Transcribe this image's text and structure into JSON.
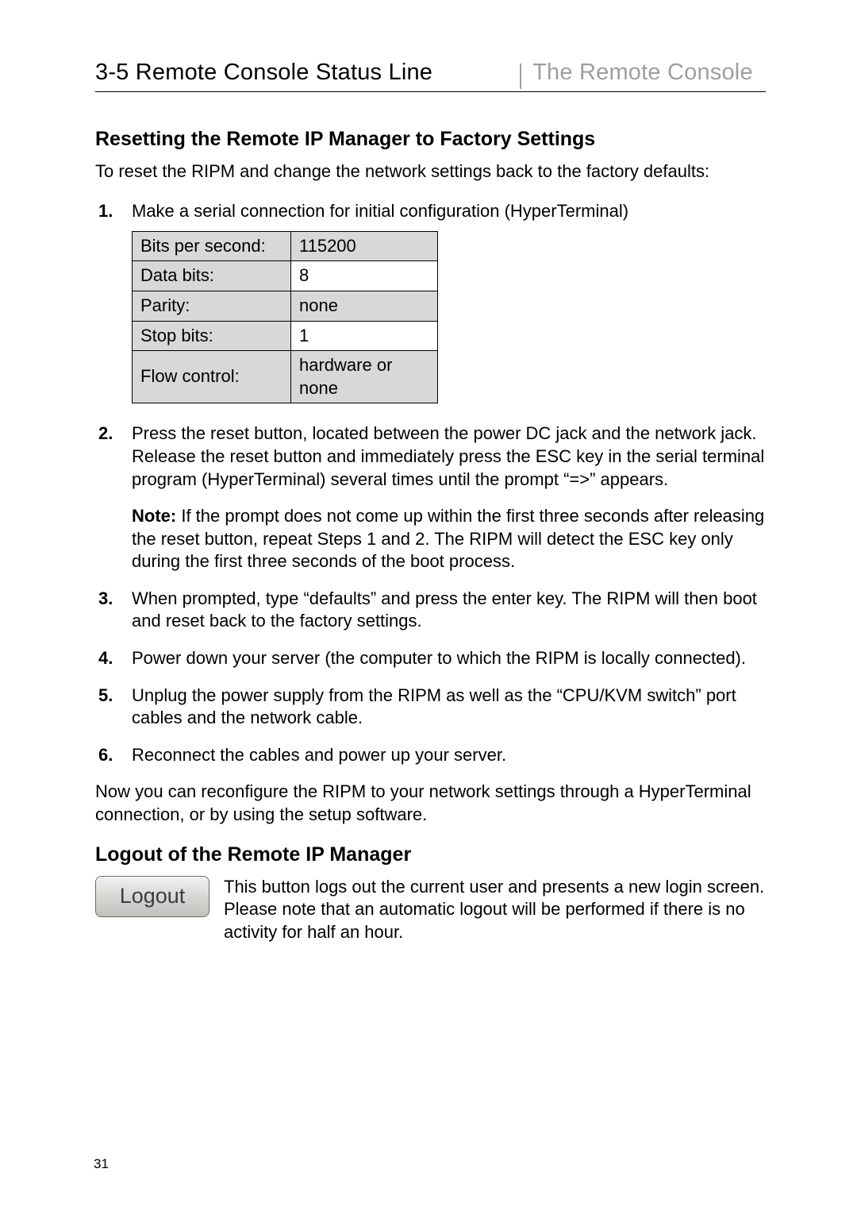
{
  "header": {
    "section_number_title": "3-5  Remote Console Status Line",
    "chapter_title": "The Remote Console"
  },
  "section1": {
    "heading": "Resetting the Remote IP Manager to Factory Settings",
    "intro": "To reset the RIPM and change the network settings back to the factory defaults:",
    "steps": {
      "1": {
        "num": "1.",
        "text": "Make a serial connection for initial configuration (HyperTerminal)"
      },
      "2": {
        "num": "2.",
        "text": "Press the reset button, located between the power DC jack and the network jack. Release the reset button and immediately press the ESC key in the serial terminal program (HyperTerminal) several times until the prompt “=>” appears.",
        "note_label": "Note:",
        "note_text": " If the prompt does not come up within the first three seconds after releasing the reset button, repeat Steps 1 and 2. The RIPM will detect the ESC key only during the first three seconds of the boot process."
      },
      "3": {
        "num": "3.",
        "text": "When prompted, type “defaults” and press the enter key. The RIPM will then boot and reset back to the factory settings."
      },
      "4": {
        "num": "4.",
        "text": "Power down your server (the computer to which the RIPM is locally connected)."
      },
      "5": {
        "num": "5.",
        "text": "Unplug the power supply from the RIPM as well as the “CPU/KVM switch” port cables and the network cable."
      },
      "6": {
        "num": "6.",
        "text": "Reconnect the cables and power up your server."
      }
    },
    "serial_table": [
      {
        "label": "Bits per second:",
        "value": "115200"
      },
      {
        "label": "Data bits:",
        "value": "8"
      },
      {
        "label": "Parity:",
        "value": "none"
      },
      {
        "label": "Stop bits:",
        "value": "1"
      },
      {
        "label": "Flow control:",
        "value": "hardware or none"
      }
    ],
    "outro": "Now you can reconfigure the RIPM to your network settings through a HyperTerminal connection, or by using the setup software."
  },
  "section2": {
    "heading": "Logout of the Remote IP Manager",
    "button_label": "Logout",
    "text": "This button logs out the current user and presents a new login screen. Please note that an automatic logout will be performed if there is no activity for half an hour."
  },
  "page_number": "31"
}
